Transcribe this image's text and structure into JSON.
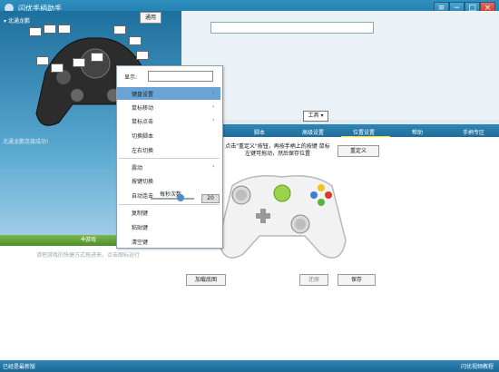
{
  "window": {
    "title": "闪优手柄助手",
    "controls": {
      "menu": "≡",
      "minimize": "−",
      "maximize": "□",
      "close": "×"
    }
  },
  "sidebar": {
    "device_name": "北通龙鹏",
    "connect_status": "北通龙鹏连接成功!",
    "games_header": "游戏",
    "games_hint": "请把游戏的快捷方式拖进来，点击图标运行"
  },
  "top": {
    "apply_label": "通用",
    "tools_label": "工具 ▾"
  },
  "tabs": [
    {
      "label": "脚本"
    },
    {
      "label": "高级设置"
    },
    {
      "label": "位置设置"
    },
    {
      "label": "帮助"
    },
    {
      "label": "手柄专区"
    }
  ],
  "main": {
    "instructions": "点击\"重定义\"按钮，再按手柄上的按键 鼠标左键可拖动，然后保存位置",
    "redefine_label": "重定义",
    "load_bg_label": "加载底图",
    "restore_label": "还原",
    "save_label": "保存"
  },
  "context_menu": {
    "display_label": "显示:",
    "items": [
      "键盘设置",
      "鼠标移动",
      "鼠标点击",
      "切换脚本",
      "左右切换",
      "震动",
      "按键切换",
      "自动连击",
      "复制键",
      "粘贴键",
      "清空键"
    ],
    "rate_label": "每秒次数",
    "rate_value": "20"
  },
  "status": {
    "left": "已经是最新版",
    "right": "闪优视频教程"
  },
  "colors": {
    "accent": "#1f73a3",
    "highlight": "#6aa3d5",
    "games_green": "#5e9c35"
  }
}
